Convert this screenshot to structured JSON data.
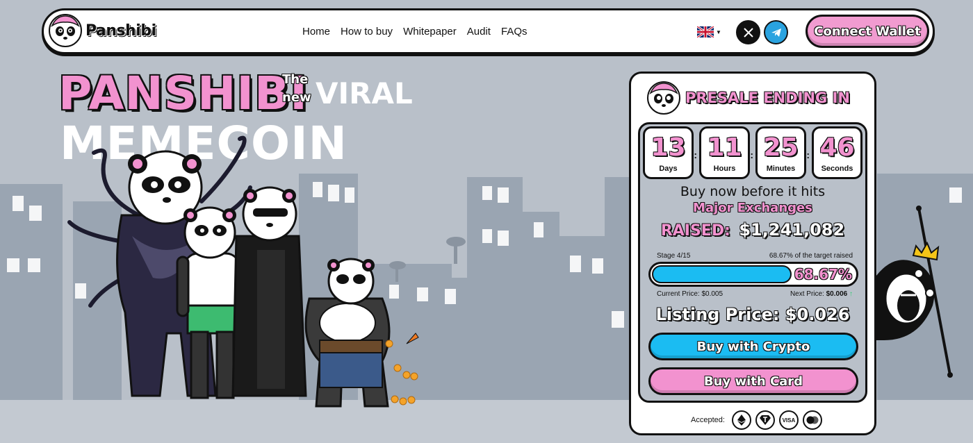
{
  "brand": {
    "name": "Panshibi"
  },
  "nav": {
    "links": [
      "Home",
      "How to buy",
      "Whitepaper",
      "Audit",
      "FAQs"
    ],
    "language": "en-GB",
    "connect_label": "Connect Wallet"
  },
  "hero": {
    "name": "PANSHIBI",
    "the": "The",
    "new": "new",
    "viral": "VIRAL",
    "memecoin": "MEMECOIN"
  },
  "presale": {
    "title": "PRESALE ENDING IN",
    "countdown": [
      {
        "value": "13",
        "label": "Days"
      },
      {
        "value": "11",
        "label": "Hours"
      },
      {
        "value": "25",
        "label": "Minutes"
      },
      {
        "value": "46",
        "label": "Seconds"
      }
    ],
    "buy_before": "Buy now before it hits",
    "exchanges": "Major Exchanges",
    "raised_label": "RAISED:",
    "raised_value": "$1,241,082",
    "stage": "Stage 4/15",
    "target_text": "68.67% of the target raised",
    "progress_percent": 68.67,
    "progress_label": "68.67%",
    "current_price": "Current Price: $0.005",
    "next_price_label": "Next Price:",
    "next_price_value": "$0.006",
    "listing_price": "Listing Price: $0.026",
    "buy_crypto": "Buy with Crypto",
    "buy_card": "Buy with Card",
    "accepted_label": "Accepted:",
    "payment_icons": [
      "ethereum-icon",
      "tether-icon",
      "visa-icon",
      "mastercard-icon"
    ],
    "visa_text": "VISA"
  },
  "colors": {
    "pink": "#f292cf",
    "blue": "#1bbcf2",
    "background": "#b9c0c9"
  }
}
